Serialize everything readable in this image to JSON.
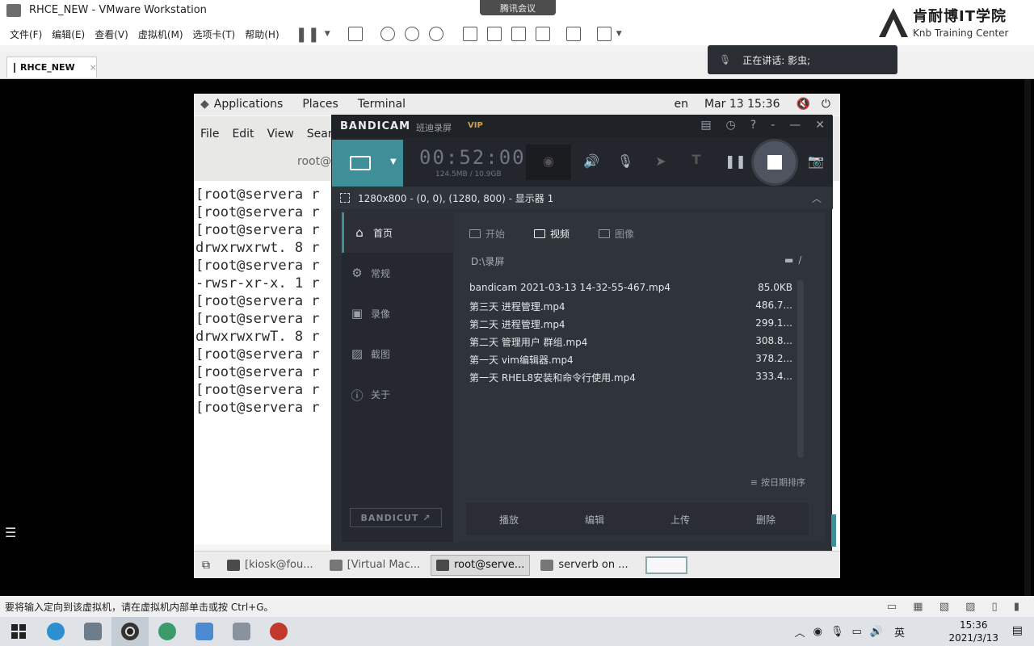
{
  "vmware": {
    "window_title": "RHCE_NEW - VMware Workstation",
    "menu": [
      "文件(F)",
      "编辑(E)",
      "查看(V)",
      "虚拟机(M)",
      "选项卡(T)",
      "帮助(H)"
    ],
    "tab_label": "RHCE_NEW",
    "status_text": "要将输入定向到该虚拟机，请在虚拟机内部单击或按 Ctrl+G。"
  },
  "overlay": {
    "meeting_label": "腾讯会议",
    "speaking": "正在讲话: 影虫;",
    "brand_cn": "肯耐博IT学院",
    "brand_en": "Knb Training Center"
  },
  "gnome": {
    "topbar_left": [
      "Applications",
      "Places",
      "Terminal"
    ],
    "lang": "en",
    "datetime": "Mar 13  15:36",
    "terminal_menu": [
      "File",
      "Edit",
      "View",
      "Searc"
    ],
    "terminal_title": "root@",
    "terminal_lines": [
      "[root@servera r",
      "[root@servera r",
      "[root@servera r",
      "drwxrwxrwt. 8 r",
      "[root@servera r",
      "-rwsr-xr-x. 1 r",
      "[root@servera r",
      "[root@servera r",
      "drwxrwxrwT. 8 r",
      "[root@servera r",
      "[root@servera r",
      "[root@servera r",
      "[root@servera r"
    ],
    "taskbar": [
      "[kiosk@fou...",
      "[Virtual Mac...",
      "root@serve...",
      "serverb on ..."
    ]
  },
  "bandicam": {
    "logo": "BANDICAM",
    "subtitle": "班迪录屏",
    "vip": "VIP",
    "timer": "00:52:00",
    "size": "124.5MB / 10.9GB",
    "region": "1280x800 - (0, 0), (1280, 800) - 显示器 1",
    "nav": [
      "首页",
      "常规",
      "录像",
      "截图",
      "关于"
    ],
    "tabs": [
      "开始",
      "视频",
      "图像"
    ],
    "path": "D:\\录屏",
    "folder": "/",
    "files": [
      {
        "name": "bandicam 2021-03-13 14-32-55-467.mp4",
        "size": "85.0KB"
      },
      {
        "name": "第三天 进程管理.mp4",
        "size": "486.7..."
      },
      {
        "name": "第二天 进程管理.mp4",
        "size": "299.1..."
      },
      {
        "name": "第二天 管理用户 群组.mp4",
        "size": "308.8..."
      },
      {
        "name": "第一天 vim编辑器.mp4",
        "size": "378.2..."
      },
      {
        "name": "第一天 RHEL8安装和命令行使用.mp4",
        "size": "333.4..."
      }
    ],
    "sort_label": "按日期排序",
    "actions": [
      "播放",
      "编辑",
      "上传",
      "删除"
    ],
    "bandicut": "BANDICUT ↗"
  },
  "windows": {
    "ime": "英",
    "time": "15:36",
    "date": "2021/3/13"
  }
}
